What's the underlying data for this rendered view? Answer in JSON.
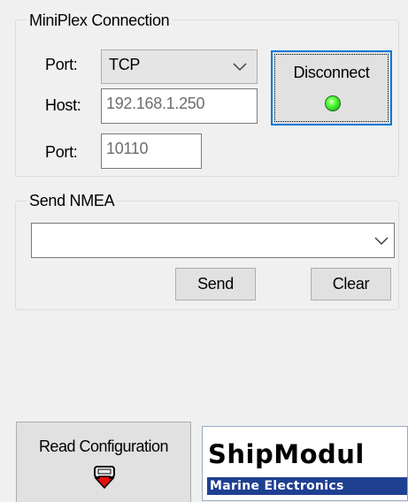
{
  "connection": {
    "title": "MiniPlex Connection",
    "port_type_label": "Port:",
    "port_type_value": "TCP",
    "host_label": "Host:",
    "host_value": "192.168.1.250",
    "port_number_label": "Port:",
    "port_number_value": "10110",
    "disconnect_label": "Disconnect",
    "status_led_color": "#33dd22"
  },
  "send_nmea": {
    "title": "Send NMEA",
    "sentence_value": "",
    "send_label": "Send",
    "clear_label": "Clear"
  },
  "footer": {
    "read_config_label": "Read Configuration",
    "download_icon": "download-arrow-icon",
    "logo_brand": "ShipModul",
    "logo_tagline": "Marine Electronics"
  },
  "colors": {
    "focus_border": "#0078d7",
    "logo_bar": "#1f3f91"
  }
}
